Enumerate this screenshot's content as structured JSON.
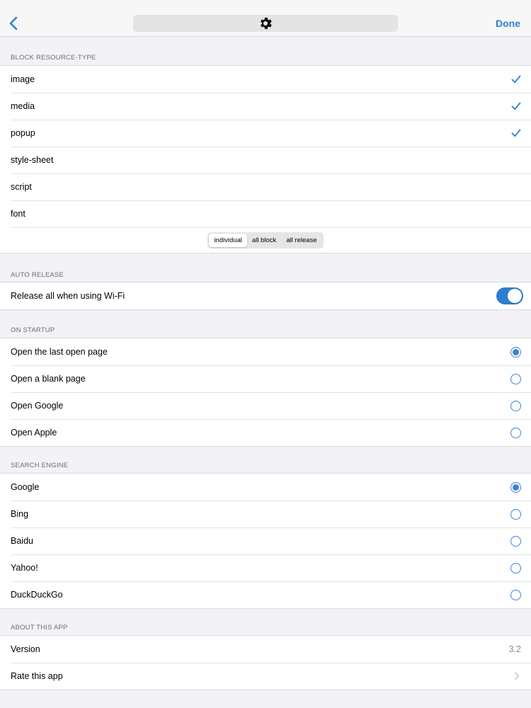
{
  "nav": {
    "done_label": "Done",
    "back_icon": "chevron-left-icon",
    "title_icon": "gear-icon"
  },
  "accent_color": "#2d7fd3",
  "block_resource": {
    "header": "BLOCK RESOURCE-TYPE",
    "items": [
      {
        "label": "image",
        "checked": true
      },
      {
        "label": "media",
        "checked": true
      },
      {
        "label": "popup",
        "checked": true
      },
      {
        "label": "style-sheet",
        "checked": false
      },
      {
        "label": "script",
        "checked": false
      },
      {
        "label": "font",
        "checked": false
      }
    ],
    "segments": [
      "individual",
      "all block",
      "all release"
    ],
    "selected_segment": "individual"
  },
  "auto_release": {
    "header": "AUTO RELEASE",
    "label": "Release all when using Wi-Fi",
    "enabled": true
  },
  "on_startup": {
    "header": "ON STARTUP",
    "options": [
      "Open the last open page",
      "Open a blank page",
      "Open Google",
      "Open Apple"
    ],
    "selected": "Open the last open page"
  },
  "search_engine": {
    "header": "SEARCH ENGINE",
    "options": [
      "Google",
      "Bing",
      "Baidu",
      "Yahoo!",
      "DuckDuckGo"
    ],
    "selected": "Google"
  },
  "about": {
    "header": "ABOUT THIS APP",
    "version_label": "Version",
    "version_value": "3.2",
    "rate_label": "Rate this app"
  }
}
